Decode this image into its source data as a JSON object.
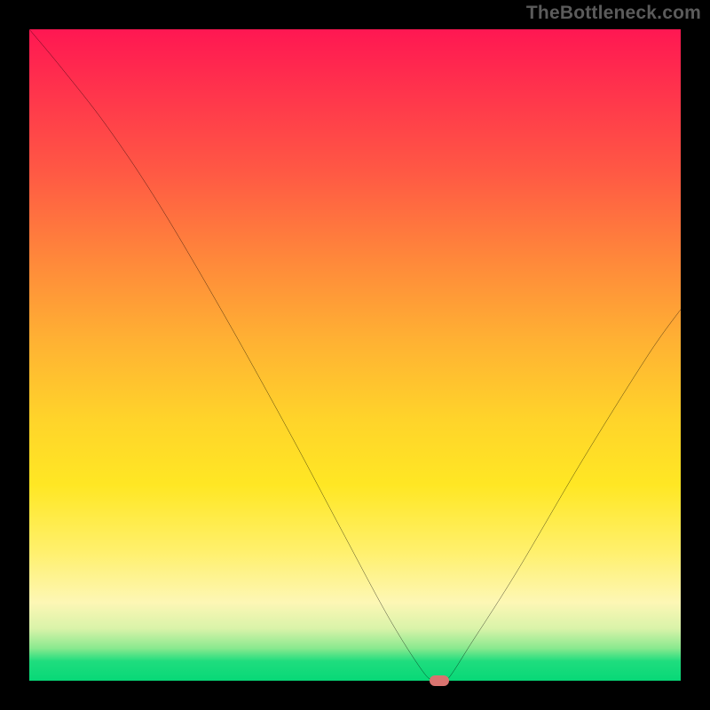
{
  "attribution": "TheBottleneck.com",
  "chart_data": {
    "type": "line",
    "title": "",
    "xlabel": "",
    "ylabel": "",
    "xlim": [
      0,
      100
    ],
    "ylim": [
      0,
      100
    ],
    "series": [
      {
        "name": "bottleneck-curve",
        "x": [
          0,
          5,
          12,
          20,
          30,
          40,
          48,
          55,
          60,
          62,
          64,
          68,
          75,
          85,
          95,
          100
        ],
        "y": [
          100,
          94,
          85,
          73,
          56,
          38,
          23,
          10,
          2,
          0,
          0,
          6,
          17,
          34,
          50,
          57
        ]
      }
    ],
    "marker": {
      "x": 63,
      "y": 0
    },
    "gradient_stops": [
      {
        "pos": 0,
        "color": "#ff1752"
      },
      {
        "pos": 22,
        "color": "#ff5944"
      },
      {
        "pos": 48,
        "color": "#ffb233"
      },
      {
        "pos": 70,
        "color": "#ffe724"
      },
      {
        "pos": 88,
        "color": "#fdf7b5"
      },
      {
        "pos": 97,
        "color": "#1fdd7e"
      },
      {
        "pos": 100,
        "color": "#07d877"
      }
    ]
  }
}
